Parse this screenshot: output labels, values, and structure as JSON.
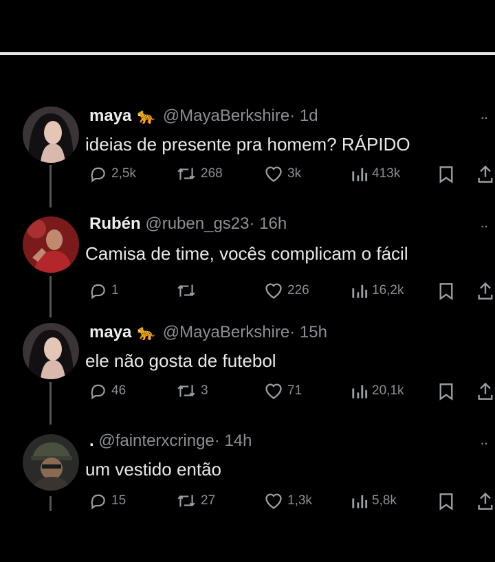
{
  "tweets": [
    {
      "name": "maya",
      "emoji": "🐆",
      "handle": "@MayaBerkshire",
      "time": "· 1d",
      "text": "ideias de presente pra homem? RÁPIDO",
      "replies": "2,5k",
      "retweets": "268",
      "likes": "3k",
      "views": "413k"
    },
    {
      "name": "Rubén",
      "emoji": "",
      "handle": "@ruben_gs23",
      "time": "· 16h",
      "text": "Camisa de time, vocês complicam o fácil",
      "replies": "1",
      "retweets": "",
      "likes": "226",
      "views": "16,2k"
    },
    {
      "name": "maya",
      "emoji": "🐆",
      "handle": "@MayaBerkshire",
      "time": "· 15h",
      "text": "ele não gosta de futebol",
      "replies": "46",
      "retweets": "3",
      "likes": "71",
      "views": "20,1k"
    },
    {
      "name": ".",
      "emoji": "",
      "handle": "@fainterxcringe",
      "time": "· 14h",
      "text": "um vestido então",
      "replies": "15",
      "retweets": "27",
      "likes": "1,3k",
      "views": "5,8k"
    }
  ],
  "more_label": "··",
  "colors": {
    "background": "#000000",
    "text": "#e7e9ea",
    "muted": "#8b8f93"
  }
}
